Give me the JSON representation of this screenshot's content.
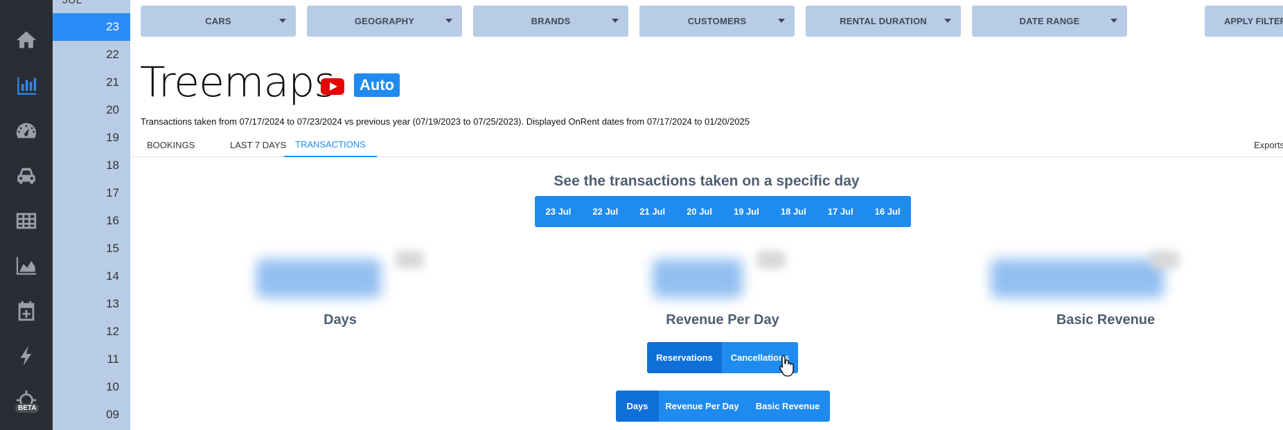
{
  "sidebar": {
    "icons": [
      "home-icon",
      "bar-chart-icon",
      "dashboard-gauge-icon",
      "car-icon",
      "table-grid-icon",
      "area-chart-icon",
      "calendar-add-icon",
      "lightning-icon",
      "crosshair-icon"
    ],
    "beta_label": "BETA",
    "active_index": 1
  },
  "days": {
    "month_label": "JUL",
    "items": [
      "23",
      "22",
      "21",
      "20",
      "19",
      "18",
      "17",
      "16",
      "15",
      "14",
      "13",
      "12",
      "11",
      "10",
      "09"
    ],
    "active": "23"
  },
  "filters": [
    "CARS",
    "GEOGRAPHY",
    "BRANDS",
    "CUSTOMERS",
    "RENTAL DURATION",
    "DATE RANGE"
  ],
  "apply_label": "APPLY FILTERS",
  "page": {
    "title": "Treemaps",
    "auto_badge": "Auto",
    "subtitle": "Transactions taken from 07/17/2024 to 07/23/2024 vs previous year (07/19/2023 to 07/25/2023). Displayed OnRent dates from 07/17/2024 to 01/20/2025"
  },
  "tabs": [
    "BOOKINGS",
    "LAST 7 DAYS",
    "TRANSACTIONS"
  ],
  "active_tab": "TRANSACTIONS",
  "exports_label": "Exports",
  "specific_day": {
    "heading": "See the transactions taken on a specific day",
    "buttons": [
      "23 Jul",
      "22 Jul",
      "21 Jul",
      "20 Jul",
      "19 Jul",
      "18 Jul",
      "17 Jul",
      "16 Jul"
    ]
  },
  "metrics": [
    "Days",
    "Revenue Per Day",
    "Basic Revenue"
  ],
  "mode_toggle": {
    "options": [
      "Reservations",
      "Cancellations"
    ],
    "selected": "Reservations"
  },
  "metric_toggle": {
    "options": [
      "Days",
      "Revenue Per Day",
      "Basic Revenue"
    ],
    "selected": "Days"
  },
  "colors": {
    "accent": "#1f8bf0",
    "sidebar_bg": "#2a2d33",
    "filter_bg": "#b8cce6",
    "youtube_red": "#e60000"
  }
}
